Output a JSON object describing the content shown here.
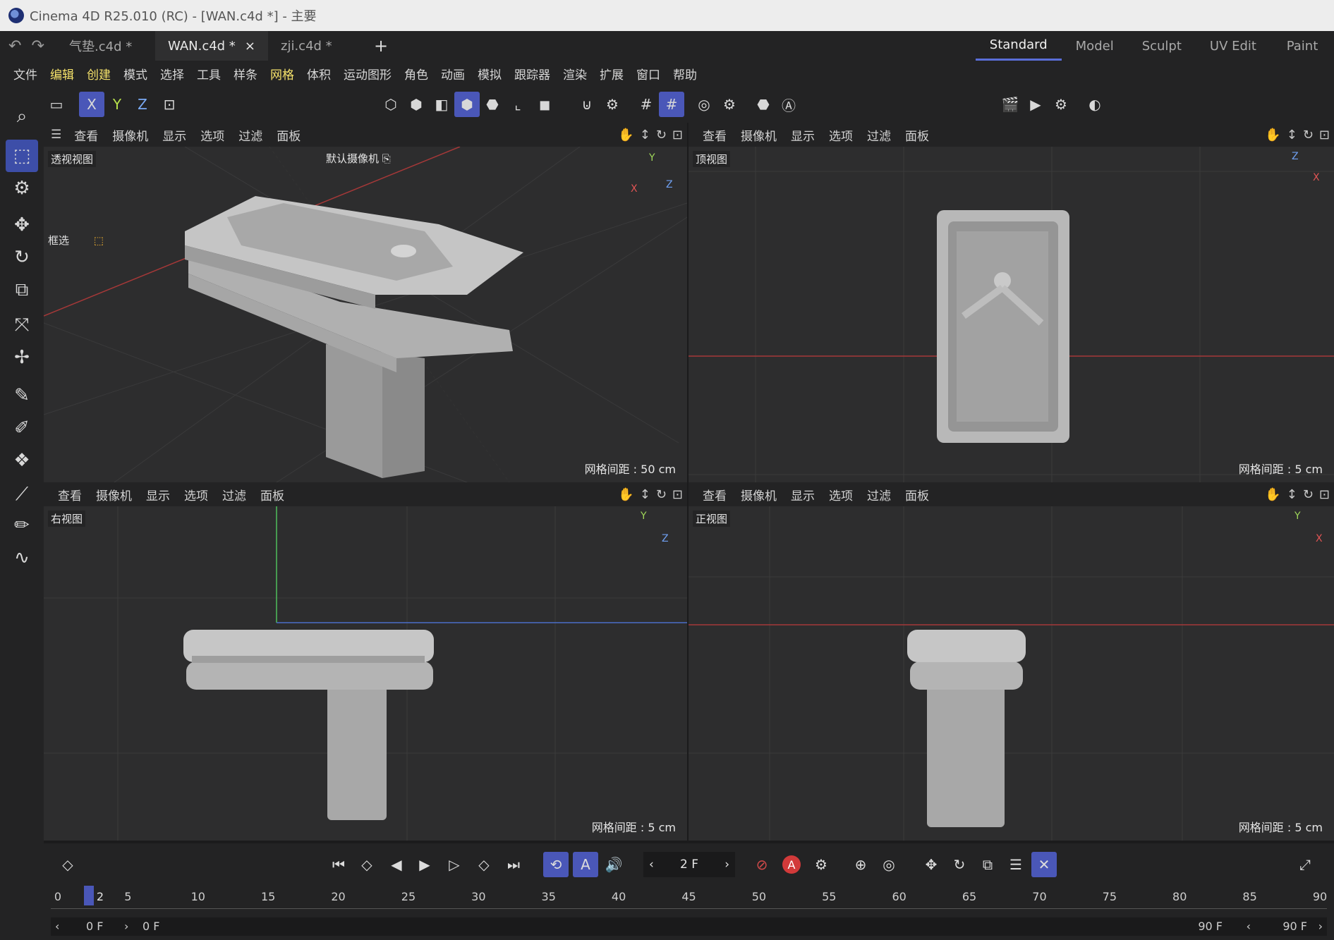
{
  "window": {
    "title": "Cinema 4D R25.010 (RC) - [WAN.c4d *] - 主要"
  },
  "tabs": [
    {
      "label": "气垫.c4d *"
    },
    {
      "label": "WAN.c4d *",
      "close": "×"
    },
    {
      "label": "zji.c4d *"
    }
  ],
  "new_tab": "+",
  "layouts": [
    "Standard",
    "Model",
    "Sculpt",
    "UV Edit",
    "Paint"
  ],
  "menu": [
    "文件",
    "编辑",
    "创建",
    "模式",
    "选择",
    "工具",
    "样条",
    "网格",
    "体积",
    "运动图形",
    "角色",
    "动画",
    "模拟",
    "跟踪器",
    "渲染",
    "扩展",
    "窗口",
    "帮助"
  ],
  "axis_lock": {
    "x": "X",
    "y": "Y",
    "z": "Z"
  },
  "viewport_menu": [
    "查看",
    "摄像机",
    "显示",
    "选项",
    "过滤",
    "面板"
  ],
  "viewports": {
    "perspective": {
      "name": "透视视图",
      "camera": "默认摄像机",
      "select_mode": "框选",
      "grid": "网格间距 : 50 cm"
    },
    "top": {
      "name": "顶视图",
      "grid": "网格间距 : 5 cm"
    },
    "right": {
      "name": "右视图",
      "grid": "网格间距 : 5 cm"
    },
    "front": {
      "name": "正视图",
      "grid": "网格间距 : 5 cm"
    }
  },
  "axes": {
    "x": "X",
    "y": "Y",
    "z": "Z"
  },
  "timeline": {
    "current_frame": "2 F",
    "ruler": [
      "0",
      "5",
      "10",
      "15",
      "20",
      "25",
      "30",
      "35",
      "40",
      "45",
      "50",
      "55",
      "60",
      "65",
      "70",
      "75",
      "80",
      "85",
      "90"
    ],
    "playhead": "2",
    "start": "0 F",
    "range_start": "0 F",
    "range_end": "90 F",
    "end": "90 F"
  }
}
